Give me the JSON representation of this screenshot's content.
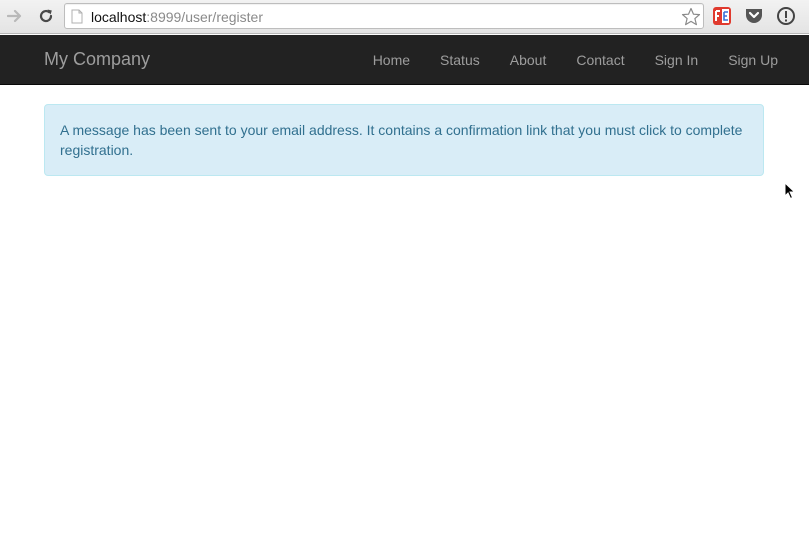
{
  "browser": {
    "url_host": "localhost",
    "url_rest": ":8999/user/register",
    "icons": [
      "forward-arrow-icon",
      "reload-icon",
      "page-icon",
      "star-icon",
      "fe-extension-icon",
      "pocket-icon",
      "info-icon"
    ]
  },
  "navbar": {
    "brand": "My Company",
    "links": [
      "Home",
      "Status",
      "About",
      "Contact",
      "Sign In",
      "Sign Up"
    ]
  },
  "alert": {
    "message": "A message has been sent to your email address. It contains a confirmation link that you must click to complete registration."
  },
  "colors": {
    "navbar_bg": "#222222",
    "nav_text": "#9d9d9d",
    "alert_bg": "#d9edf7",
    "alert_text": "#31708f"
  }
}
